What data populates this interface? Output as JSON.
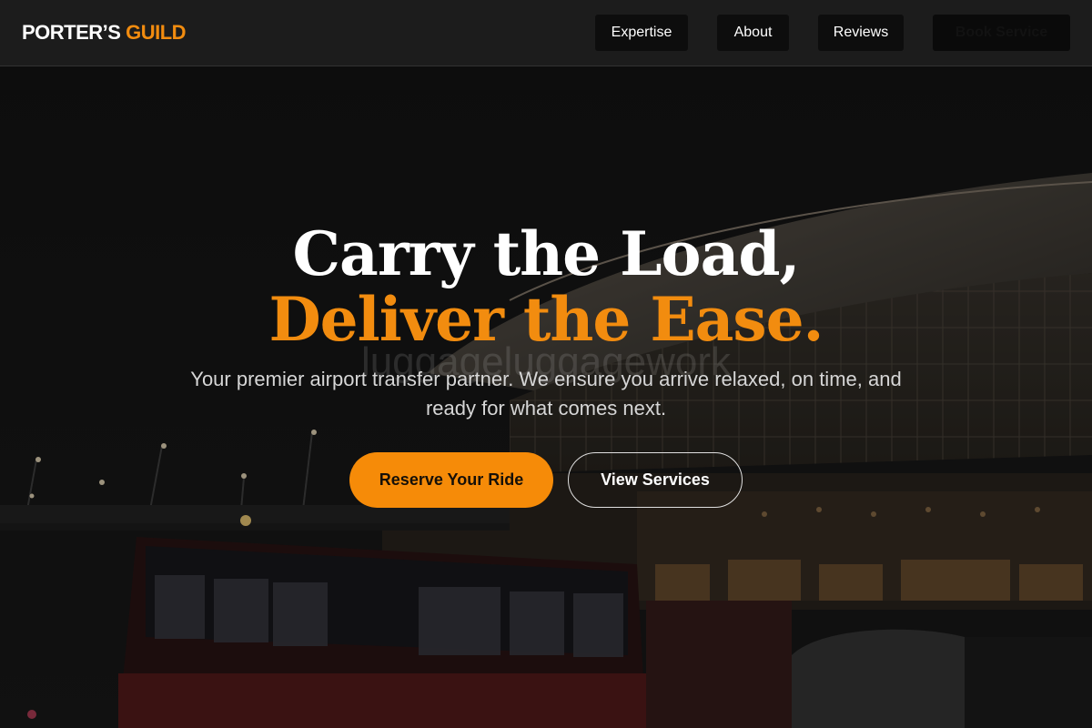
{
  "brand": {
    "name_part_a": "PORTER’S ",
    "name_part_b": "GUILD"
  },
  "nav": {
    "items": [
      {
        "label": "Expertise"
      },
      {
        "label": "About"
      },
      {
        "label": "Reviews"
      }
    ],
    "cta_label": "Book Service"
  },
  "hero": {
    "title_line1": "Carry the Load,",
    "title_line2": "Deliver the Ease.",
    "watermark": "luggageluggagework",
    "subtitle": "Your premier airport transfer partner. We ensure you arrive relaxed, on time, and ready for what comes next.",
    "primary_cta": "Reserve Your Ride",
    "secondary_cta": "View Services",
    "background_scene": "airport-terminal-night-photo"
  },
  "colors": {
    "accent": "#f28c0f",
    "header_bg": "#1c1c1c",
    "nav_button_bg": "#0d0d0d",
    "page_bg": "#141414"
  }
}
